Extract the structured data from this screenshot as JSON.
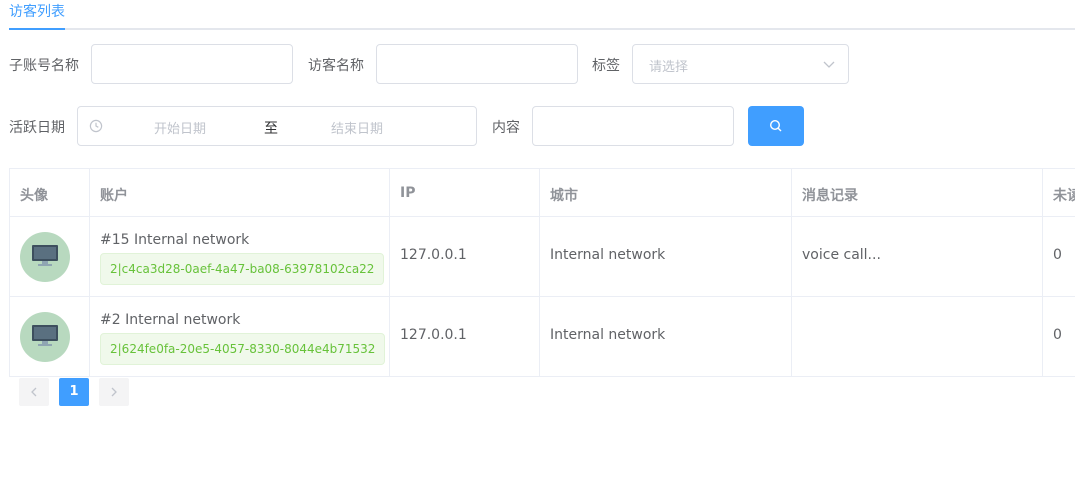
{
  "tabs": [
    {
      "label": "访客列表",
      "active": true
    }
  ],
  "filters": {
    "subaccount_label": "子账号名称",
    "subaccount_value": "",
    "visitor_label": "访客名称",
    "visitor_value": "",
    "tag_label": "标签",
    "tag_placeholder": "请选择",
    "date_label": "活跃日期",
    "date_start_placeholder": "开始日期",
    "date_separator": "至",
    "date_end_placeholder": "结束日期",
    "content_label": "内容",
    "content_value": "",
    "search_icon": "search-icon"
  },
  "table": {
    "headers": [
      "头像",
      "账户",
      "IP",
      "城市",
      "消息记录",
      "未读"
    ],
    "rows": [
      {
        "avatar_icon": "monitor-icon",
        "account_name": "#15 Internal network",
        "account_id": "2|c4ca3d28-0aef-4a47-ba08-63978102ca22",
        "ip": "127.0.0.1",
        "city": "Internal network",
        "message": "voice call...",
        "unread": "0"
      },
      {
        "avatar_icon": "monitor-icon",
        "account_name": "#2 Internal network",
        "account_id": "2|624fe0fa-20e5-4057-8330-8044e4b71532",
        "ip": "127.0.0.1",
        "city": "Internal network",
        "message": "",
        "unread": "0"
      }
    ]
  },
  "pagination": {
    "current_page": "1"
  },
  "colors": {
    "accent": "#409eff",
    "tag_bg": "#f0f9eb",
    "tag_text": "#67c23a",
    "avatar_bg": "#b8d9bf"
  }
}
